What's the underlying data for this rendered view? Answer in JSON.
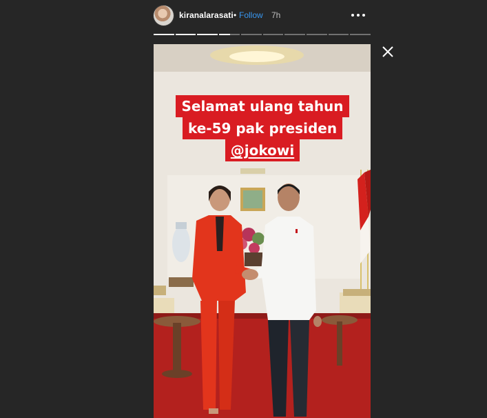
{
  "header": {
    "username": "kiranalarasati",
    "separator": "•",
    "follow_label": "Follow",
    "timestamp": "7h",
    "more_icon": "more-horizontal-icon",
    "close_icon": "close-icon"
  },
  "progress": {
    "segments": 10,
    "completed": 3,
    "current_fraction": 0.55
  },
  "story": {
    "caption_line1": "Selamat ulang tahun",
    "caption_line2": "ke-59 pak presiden",
    "mention": "@jokowi"
  },
  "colors": {
    "background": "#262626",
    "follow": "#3897f0",
    "caption_bg": "#d91c22",
    "suit_red": "#e2351c"
  }
}
